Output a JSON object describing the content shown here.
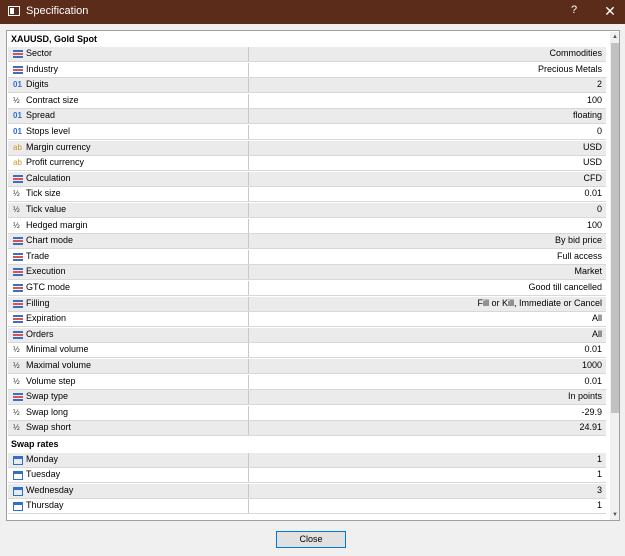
{
  "window": {
    "title": "Specification",
    "help_label": "?",
    "close_label": "✕"
  },
  "header": "XAUUSD, Gold Spot",
  "rows": [
    {
      "icon": "enum",
      "label": "Sector",
      "value": "Commodities"
    },
    {
      "icon": "enum",
      "label": "Industry",
      "value": "Precious Metals"
    },
    {
      "icon": "int",
      "label": "Digits",
      "value": "2"
    },
    {
      "icon": "frac",
      "label": "Contract size",
      "value": "100"
    },
    {
      "icon": "int",
      "label": "Spread",
      "value": "floating"
    },
    {
      "icon": "int",
      "label": "Stops level",
      "value": "0"
    },
    {
      "icon": "str",
      "label": "Margin currency",
      "value": "USD"
    },
    {
      "icon": "str",
      "label": "Profit currency",
      "value": "USD"
    },
    {
      "icon": "enum",
      "label": "Calculation",
      "value": "CFD"
    },
    {
      "icon": "frac",
      "label": "Tick size",
      "value": "0.01"
    },
    {
      "icon": "frac",
      "label": "Tick value",
      "value": "0"
    },
    {
      "icon": "frac",
      "label": "Hedged margin",
      "value": "100"
    },
    {
      "icon": "enum",
      "label": "Chart mode",
      "value": "By bid price"
    },
    {
      "icon": "enum",
      "label": "Trade",
      "value": "Full access"
    },
    {
      "icon": "enum",
      "label": "Execution",
      "value": "Market"
    },
    {
      "icon": "enum",
      "label": "GTC mode",
      "value": "Good till cancelled"
    },
    {
      "icon": "enum",
      "label": "Filling",
      "value": "Fill or Kill, Immediate or Cancel"
    },
    {
      "icon": "enum",
      "label": "Expiration",
      "value": "All"
    },
    {
      "icon": "enum",
      "label": "Orders",
      "value": "All"
    },
    {
      "icon": "frac",
      "label": "Minimal volume",
      "value": "0.01"
    },
    {
      "icon": "frac",
      "label": "Maximal volume",
      "value": "1000"
    },
    {
      "icon": "frac",
      "label": "Volume step",
      "value": "0.01"
    },
    {
      "icon": "enum",
      "label": "Swap type",
      "value": "In points"
    },
    {
      "icon": "frac",
      "label": "Swap long",
      "value": "-29.9"
    },
    {
      "icon": "frac",
      "label": "Swap short",
      "value": "24.91"
    }
  ],
  "swap_section": "Swap rates",
  "swap_rows": [
    {
      "label": "Monday",
      "value": "1"
    },
    {
      "label": "Tuesday",
      "value": "1"
    },
    {
      "label": "Wednesday",
      "value": "3"
    },
    {
      "label": "Thursday",
      "value": "1"
    }
  ],
  "icon_glyphs": {
    "int": "01",
    "frac": "½",
    "str": "ab"
  },
  "close_button": "Close"
}
